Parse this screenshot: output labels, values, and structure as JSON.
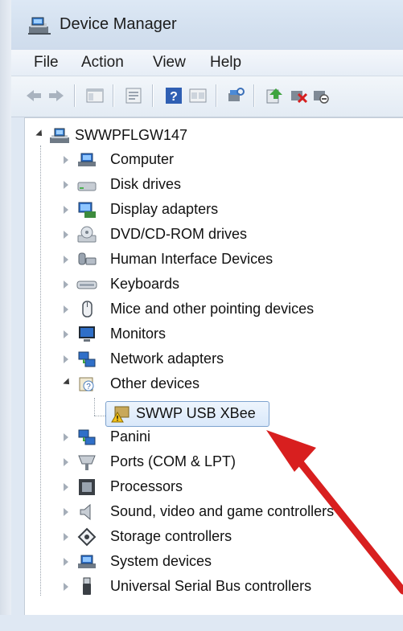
{
  "window": {
    "title": "Device Manager"
  },
  "menu": {
    "items": [
      "File",
      "Action",
      "View",
      "Help"
    ]
  },
  "toolbar": {
    "buttons": [
      "back-icon",
      "forward-icon",
      "show-hide-console-tree-icon",
      "properties-icon",
      "help-icon",
      "view-icon",
      "scan-hardware-icon",
      "update-driver-icon",
      "uninstall-icon",
      "disable-icon"
    ]
  },
  "tree": {
    "root": {
      "label": "SWWPFLGW147",
      "icon": "computer-icon"
    },
    "categories": [
      {
        "label": "Computer",
        "icon": "computer-icon"
      },
      {
        "label": "Disk drives",
        "icon": "disk-drive-icon"
      },
      {
        "label": "Display adapters",
        "icon": "display-adapter-icon"
      },
      {
        "label": "DVD/CD-ROM drives",
        "icon": "dvd-drive-icon"
      },
      {
        "label": "Human Interface Devices",
        "icon": "hid-icon"
      },
      {
        "label": "Keyboards",
        "icon": "keyboard-icon"
      },
      {
        "label": "Mice and other pointing devices",
        "icon": "mouse-icon"
      },
      {
        "label": "Monitors",
        "icon": "monitor-icon"
      },
      {
        "label": "Network adapters",
        "icon": "network-adapter-icon"
      },
      {
        "label": "Other devices",
        "icon": "other-devices-icon",
        "expanded": true,
        "children": [
          {
            "label": "SWWP USB XBee",
            "icon": "warning-device-icon",
            "selected": true
          }
        ]
      },
      {
        "label": "Panini",
        "icon": "network-adapter-icon"
      },
      {
        "label": "Ports (COM & LPT)",
        "icon": "port-icon"
      },
      {
        "label": "Processors",
        "icon": "processor-icon"
      },
      {
        "label": "Sound, video and game controllers",
        "icon": "sound-icon"
      },
      {
        "label": "Storage controllers",
        "icon": "storage-controller-icon"
      },
      {
        "label": "System devices",
        "icon": "system-devices-icon"
      },
      {
        "label": "Universal Serial Bus controllers",
        "icon": "usb-icon"
      }
    ]
  },
  "annotation": {
    "arrow_color": "#d81f1f"
  }
}
